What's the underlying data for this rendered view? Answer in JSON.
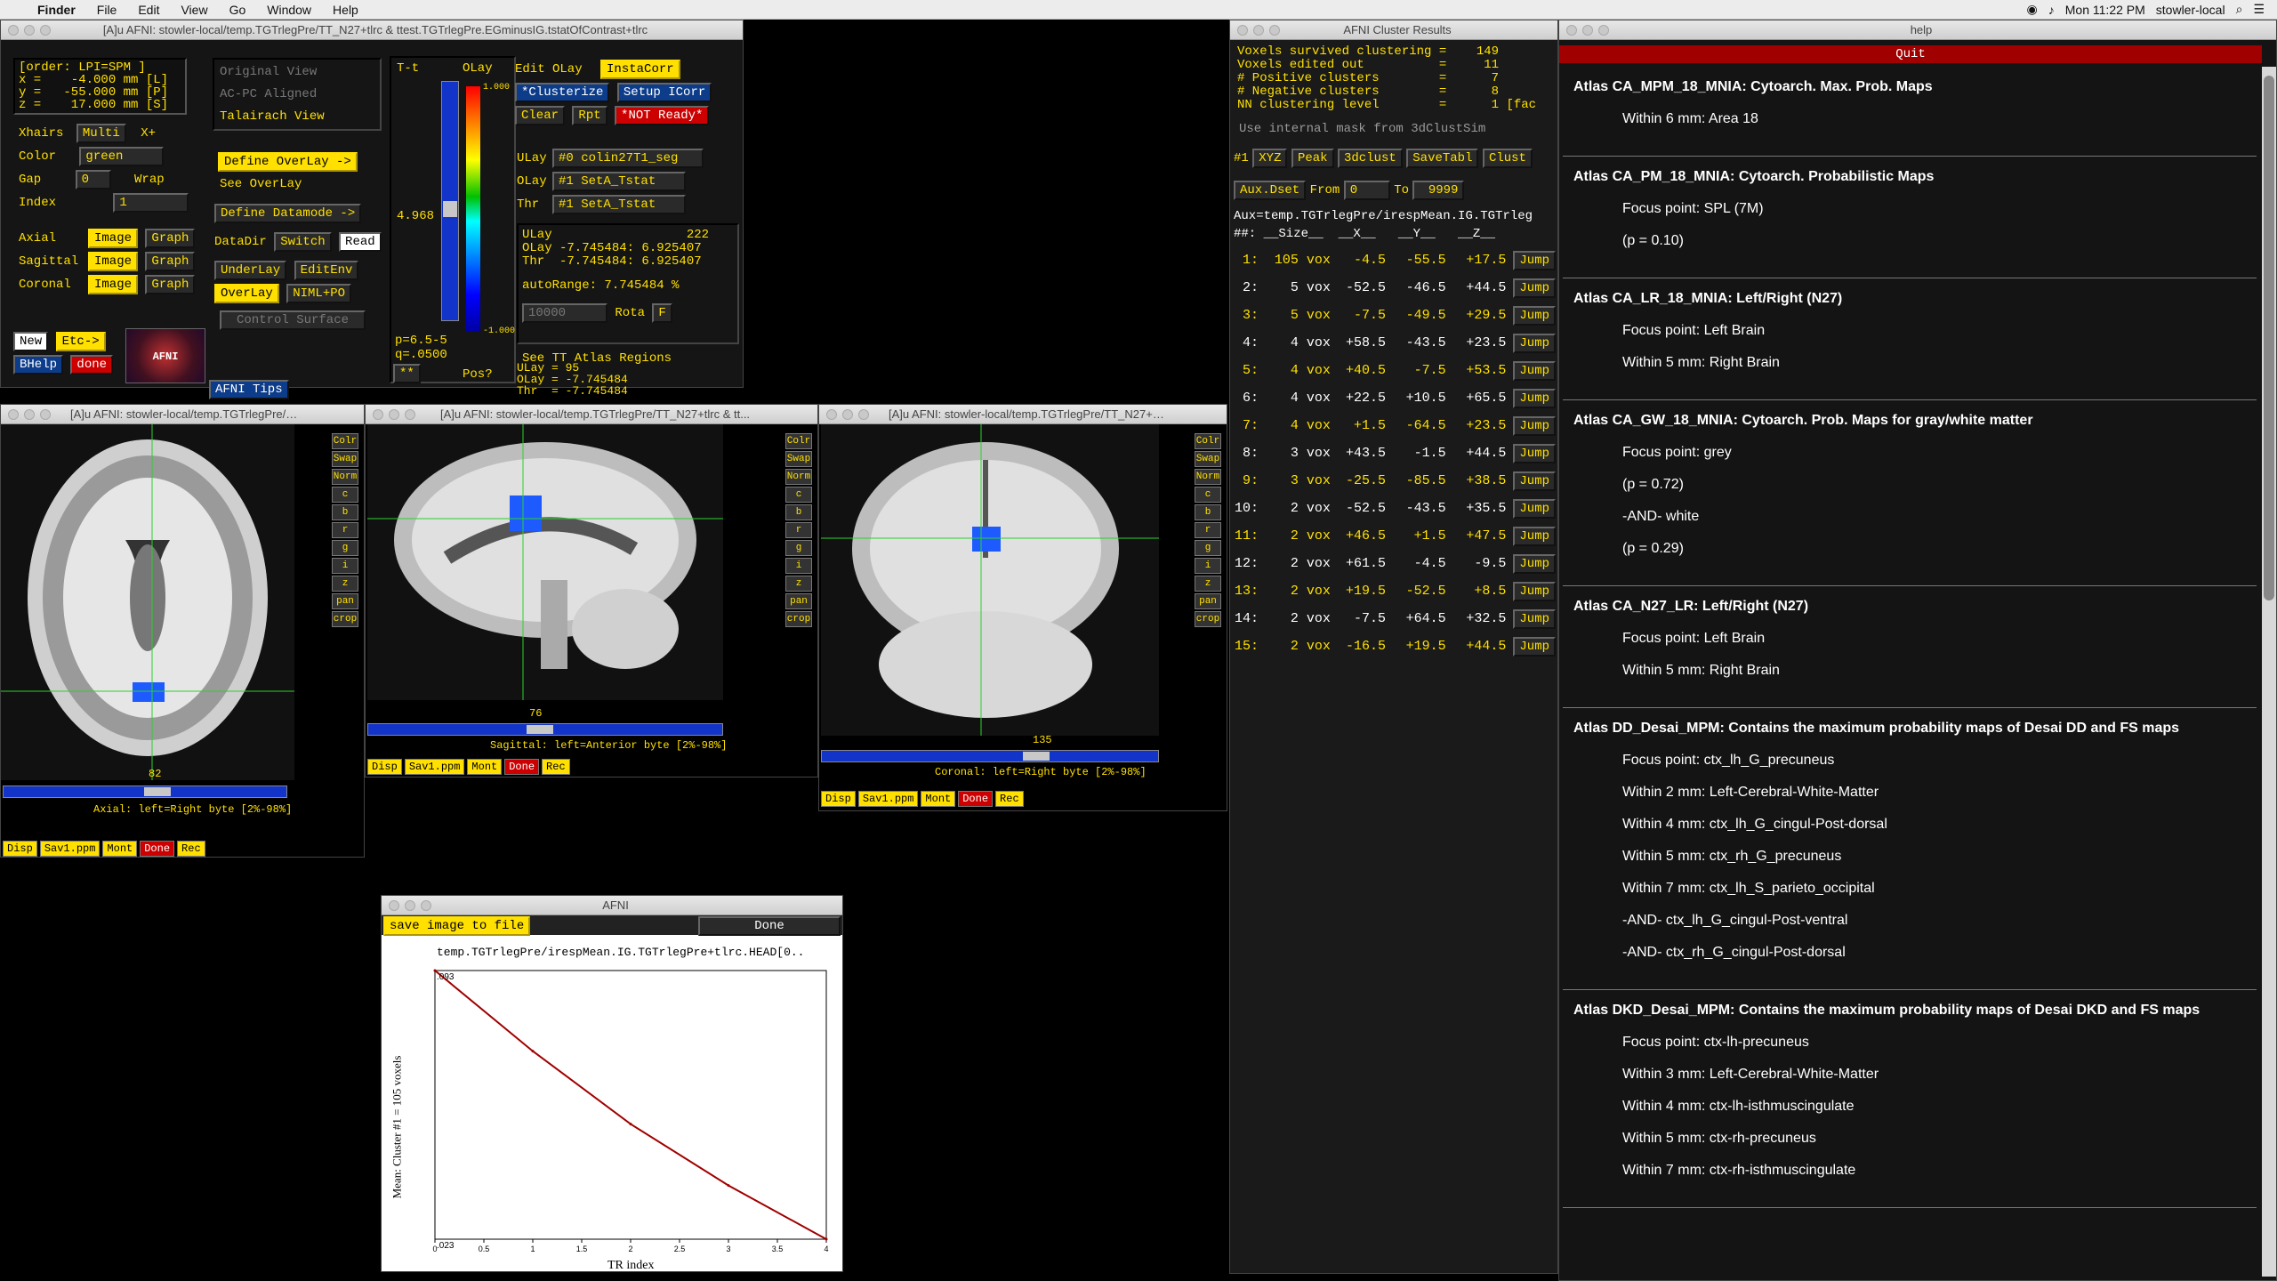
{
  "menubar": {
    "app": "Finder",
    "items": [
      "File",
      "Edit",
      "View",
      "Go",
      "Window",
      "Help"
    ],
    "clock": "Mon 11:22 PM",
    "user": "stowler-local"
  },
  "main_window": {
    "title": "[A]u AFNI: stowler-local/temp.TGTrlegPre/TT_N27+tlrc & ttest.TGTrlegPre.EGminusIG.tstatOfContrast+tlrc",
    "coords": [
      "[order: LPI=SPM ]",
      "x =    -4.000 mm [L]",
      "y =   -55.000 mm [P]",
      "z =    17.000 mm [S]"
    ],
    "xhairs_label": "Xhairs",
    "xhairs_value": "Multi",
    "xplus": "X+",
    "color_label": "Color",
    "color_value": "green",
    "gap_label": "Gap",
    "gap_value": "0",
    "wrap": "Wrap",
    "index_label": "Index",
    "index_value": "1",
    "views": [
      {
        "name": "Axial",
        "image": "Image",
        "graph": "Graph"
      },
      {
        "name": "Sagittal",
        "image": "Image",
        "graph": "Graph"
      },
      {
        "name": "Coronal",
        "image": "Image",
        "graph": "Graph"
      }
    ],
    "new": "New",
    "etc": "Etc->",
    "bhelp": "BHelp",
    "done": "done",
    "logo": "AFNI",
    "tips": "AFNI Tips",
    "view_opts": [
      "Original View",
      "AC-PC Aligned",
      "Talairach View"
    ],
    "define_overlay": "Define OverLay ->",
    "see_overlay": "See OverLay",
    "define_datamode": "Define Datamode ->",
    "datadir": "DataDir",
    "switch": "Switch",
    "read": "Read",
    "underlay": "UnderLay",
    "editenv": "EditEnv",
    "overlay": "OverLay",
    "nimlpo": "NIML+PO",
    "control_surface": "Control Surface",
    "tt": "T-t",
    "olay": "OLay",
    "scale_top": "1.000",
    "scale_bot": "-1.000",
    "thr_value": "4.968",
    "p_info": "p=6.5-5",
    "q_info": "q=.0500",
    "stars": "**",
    "pos": "Pos?",
    "edit_olay": "Edit OLay",
    "instacorr": "InstaCorr",
    "clusterize": "*Clusterize",
    "setup_icorr": "Setup ICorr",
    "clear": "Clear",
    "rpt": "Rpt",
    "not_ready": "*NOT Ready*",
    "ulay_label": "ULay",
    "ulay_value": "#0 colin27T1_seg",
    "olay_label": "OLay",
    "olay_value": "#1 SetA_Tstat",
    "thr_label": "Thr",
    "thr_value2": "#1 SetA_Tstat",
    "info_ulay": "ULay                  222",
    "info_olay": "OLay -7.745484: 6.925407",
    "info_thr": "Thr  -7.745484: 6.925407",
    "autorange": "autoRange: 7.745484",
    "pct": "%",
    "range_val": "10000",
    "rota": "Rota",
    "f": "F",
    "see_tt": "See TT Atlas Regions",
    "val_ulay": "ULay = 95",
    "val_olay": "OLay = -7.745484",
    "val_thr": "Thr  = -7.745484"
  },
  "axial": {
    "title": "[A]u AFNI: stowler-local/temp.TGTrlegPre/TT...",
    "slice": "82",
    "caption": "Axial: left=Right byte [2%-98%]"
  },
  "sagittal": {
    "title": "[A]u AFNI: stowler-local/temp.TGTrlegPre/TT_N27+tlrc & tt...",
    "slice": "76",
    "caption": "Sagittal: left=Anterior byte [2%-98%]"
  },
  "coronal": {
    "title": "[A]u AFNI: stowler-local/temp.TGTrlegPre/TT_N27+tlr...",
    "slice": "135",
    "caption": "Coronal: left=Right byte [2%-98%]"
  },
  "side_buttons": [
    "Colr",
    "Swap",
    "Norm",
    "c",
    "b",
    "r",
    "g",
    "i",
    "z",
    "pan",
    "crop"
  ],
  "img_bottom": [
    "Disp",
    "Sav1.ppm",
    "Mont",
    "Done",
    "Rec"
  ],
  "graph": {
    "title": "AFNI",
    "save": "save image to file",
    "done": "Done",
    "file": "temp.TGTrlegPre/irespMean.IG.TGTrlegPre+tlrc.HEAD[0..",
    "ylabel": "Mean: Cluster #1 = 105 voxels",
    "xlabel": "TR index",
    "ytop": ".093",
    "ybot": ".023",
    "xticks": [
      "0",
      "0.5",
      "1",
      "1.5",
      "2",
      "2.5",
      "3",
      "3.5",
      "4"
    ]
  },
  "chart_data": {
    "type": "line",
    "x": [
      0,
      1,
      2,
      3,
      4
    ],
    "values": [
      0.093,
      0.072,
      0.053,
      0.037,
      0.023
    ],
    "xlabel": "TR index",
    "ylabel": "Mean: Cluster #1 = 105 voxels",
    "ylim": [
      0.023,
      0.093
    ],
    "xlim": [
      0,
      4
    ],
    "color": "#a00000"
  },
  "cluster": {
    "title": "AFNI Cluster Results",
    "summary": [
      "Voxels survived clustering =    149",
      "Voxels edited out          =     11",
      "# Positive clusters        =      7",
      "# Negative clusters        =      8",
      "NN clustering level        =      1 [fac"
    ],
    "use_mask": "Use internal mask from 3dClustSim",
    "hash1": "#1",
    "xyz": "XYZ",
    "peak": "Peak",
    "clust3d": "3dclust",
    "savetabl": "SaveTabl",
    "clust": "Clust",
    "auxdset": "Aux.Dset",
    "from": "From",
    "from_val": "0",
    "to": "To",
    "to_val": "9999",
    "aux": "Aux=temp.TGTrlegPre/irespMean.IG.TGTrleg",
    "header": "##: __Size__  __X__   __Y__   __Z__",
    "jump": "Jump",
    "rows": [
      [
        "1:",
        "105 vox",
        "-4.5",
        "-55.5",
        "+17.5"
      ],
      [
        "2:",
        "5 vox",
        "-52.5",
        "-46.5",
        "+44.5"
      ],
      [
        "3:",
        "5 vox",
        "-7.5",
        "-49.5",
        "+29.5"
      ],
      [
        "4:",
        "4 vox",
        "+58.5",
        "-43.5",
        "+23.5"
      ],
      [
        "5:",
        "4 vox",
        "+40.5",
        "-7.5",
        "+53.5"
      ],
      [
        "6:",
        "4 vox",
        "+22.5",
        "+10.5",
        "+65.5"
      ],
      [
        "7:",
        "4 vox",
        "+1.5",
        "-64.5",
        "+23.5"
      ],
      [
        "8:",
        "3 vox",
        "+43.5",
        "-1.5",
        "+44.5"
      ],
      [
        "9:",
        "3 vox",
        "-25.5",
        "-85.5",
        "+38.5"
      ],
      [
        "10:",
        "2 vox",
        "-52.5",
        "-43.5",
        "+35.5"
      ],
      [
        "11:",
        "2 vox",
        "+46.5",
        "+1.5",
        "+47.5"
      ],
      [
        "12:",
        "2 vox",
        "+61.5",
        "-4.5",
        "-9.5"
      ],
      [
        "13:",
        "2 vox",
        "+19.5",
        "-52.5",
        "+8.5"
      ],
      [
        "14:",
        "2 vox",
        "-7.5",
        "+64.5",
        "+32.5"
      ],
      [
        "15:",
        "2 vox",
        "-16.5",
        "+19.5",
        "+44.5"
      ]
    ]
  },
  "help": {
    "title": "help",
    "quit": "Quit",
    "sections": [
      {
        "h": "Atlas CA_MPM_18_MNIA: Cytoarch. Max. Prob. Maps",
        "lines": [
          "Within 6 mm: Area 18"
        ]
      },
      {
        "h": "Atlas CA_PM_18_MNIA: Cytoarch. Probabilistic Maps",
        "lines": [
          "Focus point: SPL (7M)",
          "(p = 0.10)"
        ]
      },
      {
        "h": "Atlas CA_LR_18_MNIA: Left/Right (N27)",
        "lines": [
          "Focus point: Left Brain",
          "Within 5 mm: Right Brain"
        ]
      },
      {
        "h": "Atlas CA_GW_18_MNIA: Cytoarch. Prob. Maps for gray/white matter",
        "lines": [
          "Focus point: grey",
          "(p = 0.72)",
          "-AND- white",
          "(p = 0.29)"
        ]
      },
      {
        "h": "Atlas CA_N27_LR: Left/Right (N27)",
        "lines": [
          "Focus point: Left Brain",
          "Within 5 mm: Right Brain"
        ]
      },
      {
        "h": "Atlas DD_Desai_MPM: Contains the maximum probability maps of Desai DD and FS maps",
        "lines": [
          "Focus point: ctx_lh_G_precuneus",
          "Within 2 mm: Left-Cerebral-White-Matter",
          "Within 4 mm: ctx_lh_G_cingul-Post-dorsal",
          "Within 5 mm: ctx_rh_G_precuneus",
          "Within 7 mm: ctx_lh_S_parieto_occipital",
          "-AND- ctx_lh_G_cingul-Post-ventral",
          "-AND- ctx_rh_G_cingul-Post-dorsal"
        ]
      },
      {
        "h": "Atlas DKD_Desai_MPM: Contains the maximum probability maps of Desai DKD and FS maps",
        "lines": [
          "Focus point: ctx-lh-precuneus",
          "Within 3 mm: Left-Cerebral-White-Matter",
          "Within 4 mm: ctx-lh-isthmuscingulate",
          "Within 5 mm: ctx-rh-precuneus",
          "Within 7 mm: ctx-rh-isthmuscingulate"
        ]
      }
    ]
  }
}
